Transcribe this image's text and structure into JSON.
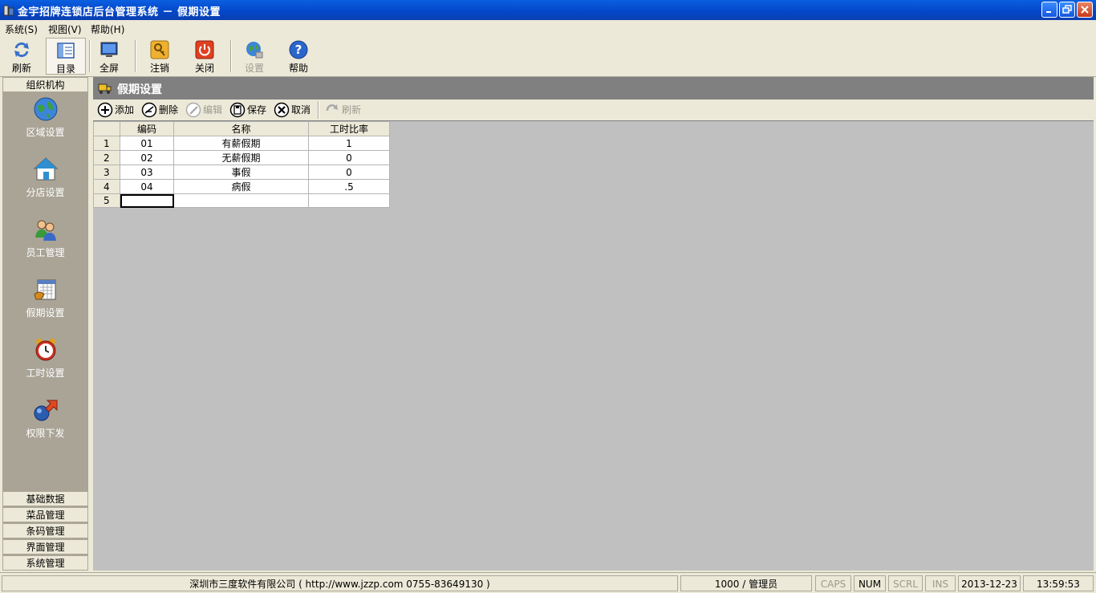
{
  "window": {
    "title": "金宇招牌连锁店后台管理系统 － 假期设置"
  },
  "menu": [
    {
      "label": "系统(S)"
    },
    {
      "label": "视图(V)"
    },
    {
      "label": "帮助(H)"
    }
  ],
  "toolbar": {
    "refresh": "刷新",
    "catalog": "目录",
    "fullscreen": "全屏",
    "logout": "注销",
    "close": "关闭",
    "settings": "设置",
    "help": "帮助"
  },
  "sidebar": {
    "header": "组织机构",
    "items": [
      {
        "label": "区域设置",
        "icon": "globe-icon"
      },
      {
        "label": "分店设置",
        "icon": "house-icon"
      },
      {
        "label": "员工管理",
        "icon": "users-icon"
      },
      {
        "label": "假期设置",
        "icon": "calendar-icon"
      },
      {
        "label": "工时设置",
        "icon": "alarm-clock-icon"
      },
      {
        "label": "权限下发",
        "icon": "permission-arrow-icon"
      }
    ],
    "bottom": [
      "基础数据",
      "菜品管理",
      "条码管理",
      "界面管理",
      "系统管理"
    ]
  },
  "content": {
    "title": "假期设置",
    "toolbar": {
      "add": "添加",
      "delete": "删除",
      "edit": "编辑",
      "save": "保存",
      "cancel": "取消",
      "refresh": "刷新"
    },
    "table": {
      "columns": [
        "编码",
        "名称",
        "工时比率"
      ],
      "rows": [
        {
          "n": "1",
          "code": "01",
          "name": "有薪假期",
          "ratio": "1"
        },
        {
          "n": "2",
          "code": "02",
          "name": "无薪假期",
          "ratio": "0"
        },
        {
          "n": "3",
          "code": "03",
          "name": "事假",
          "ratio": "0"
        },
        {
          "n": "4",
          "code": "04",
          "name": "病假",
          "ratio": ".5"
        },
        {
          "n": "5",
          "code": "",
          "name": "",
          "ratio": ""
        }
      ]
    }
  },
  "status": {
    "company": "深圳市三度软件有限公司 ( http://www.jzzp.com  0755-83649130 )",
    "user": "1000 / 管理员",
    "caps": "CAPS",
    "num": "NUM",
    "scrl": "SCRL",
    "ins": "INS",
    "date": "2013-12-23",
    "time": "13:59:53"
  },
  "colors": {
    "titlebar": "#0a5fe0",
    "sidebar": "#aaa497",
    "workspace": "#c0c0c0",
    "header": "#808080"
  }
}
